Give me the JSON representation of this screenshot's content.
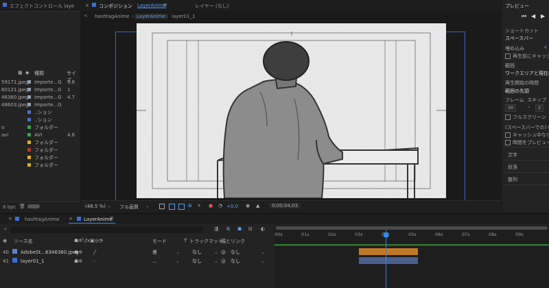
{
  "left_panel": {
    "tab_title": "エフェクトコントロール laye",
    "col_type": "種類",
    "col_size": "サイズ",
    "items": [
      {
        "name": "59171.jpeg",
        "color": "#8fa0b8",
        "type": "Importe...G",
        "size": "5.6"
      },
      {
        "name": "60121.jpeg",
        "color": "#8fa0b8",
        "type": "Importe...G",
        "size": "1"
      },
      {
        "name": "46360.jpeg",
        "color": "#8fa0b8",
        "type": "Importe...G",
        "size": "4.7"
      },
      {
        "name": "48603.jpeg",
        "color": "#8fa0b8",
        "type": "Importe...G",
        "size": ""
      },
      {
        "name": "",
        "color": "#4a6fd0",
        "type": "..ション",
        "size": ""
      },
      {
        "name": "",
        "color": "#4a6fd0",
        "type": "..ション",
        "size": ""
      },
      {
        "name": "o",
        "color": "#3aa34a",
        "type": "フォルダー",
        "size": ""
      },
      {
        "name": "avi",
        "color": "#3aa34a",
        "type": "AVI",
        "size": "4.6"
      },
      {
        "name": "",
        "color": "#e0b020",
        "type": "フォルダー",
        "size": ""
      },
      {
        "name": "",
        "color": "#c03a2a",
        "type": "フォルダー",
        "size": ""
      },
      {
        "name": "",
        "color": "#e0b020",
        "type": "フォルダー",
        "size": ""
      },
      {
        "name": "",
        "color": "#e0b020",
        "type": "フォルダー",
        "size": ""
      }
    ],
    "bpc": "8 bpc"
  },
  "comp_panel": {
    "tab_title": "コンポジション",
    "tab_comp": "LayerAnime",
    "tab_layer": "レイヤー (なし)",
    "breadcrumbs": [
      "hashtagAnime",
      "LayerAnime",
      "layer01_1"
    ],
    "zoom": "(48.5 %)",
    "resolution": "フル画質",
    "exposure": "+0.0",
    "timecode": "0;00;04;03"
  },
  "right_panel": {
    "title": "プレビュー",
    "shortcut_label": "ショートカット",
    "shortcut_value": "スペースバー",
    "embed_label": "埋め込み",
    "play_before_cache": "再生前にキャッシ",
    "range_label": "範囲",
    "range_value": "ワークエリアと現在の",
    "start_label": "再生開始の時間",
    "start_value": "範囲の先頭",
    "frame_label": "フレーム",
    "skip_label": "スキップ",
    "frame_value": "30",
    "skip_value": "2",
    "fullscreen": "フルスクリーン",
    "stop_label": "(スペースバーでの) 停",
    "cache_when": "キャッシュ中なら再",
    "time_preview": "時間をプレビュー時",
    "sections": [
      "文字",
      "段落",
      "整列"
    ]
  },
  "timeline": {
    "tabs": [
      "hashtagAnime",
      "LayerAnime"
    ],
    "search_placeholder": "",
    "col_source": "ソース名",
    "col_mode": "モード",
    "col_t": "T",
    "col_trackmatte": "トラックマット",
    "col_parent": "親とリンク",
    "layers": [
      {
        "num": "40",
        "name": "AdobeSt...6346360.jpeg",
        "mode": "差",
        "track": "なし",
        "parent": "なし",
        "bar_color": "#c07a26"
      },
      {
        "num": "41",
        "name": "layer01_1",
        "mode": "...",
        "track": "なし",
        "parent": "なし",
        "bar_color": "#4a5f8c"
      }
    ],
    "ruler": [
      "00s",
      "01s",
      "02s",
      "03s",
      "04s",
      "05s",
      "06s",
      "07s",
      "08s",
      "09s"
    ],
    "playhead_s": 4.1
  },
  "colors": {
    "accent": "#2d8ceb",
    "panel_bg": "#232323",
    "comp_frame": "#4a62c8"
  }
}
